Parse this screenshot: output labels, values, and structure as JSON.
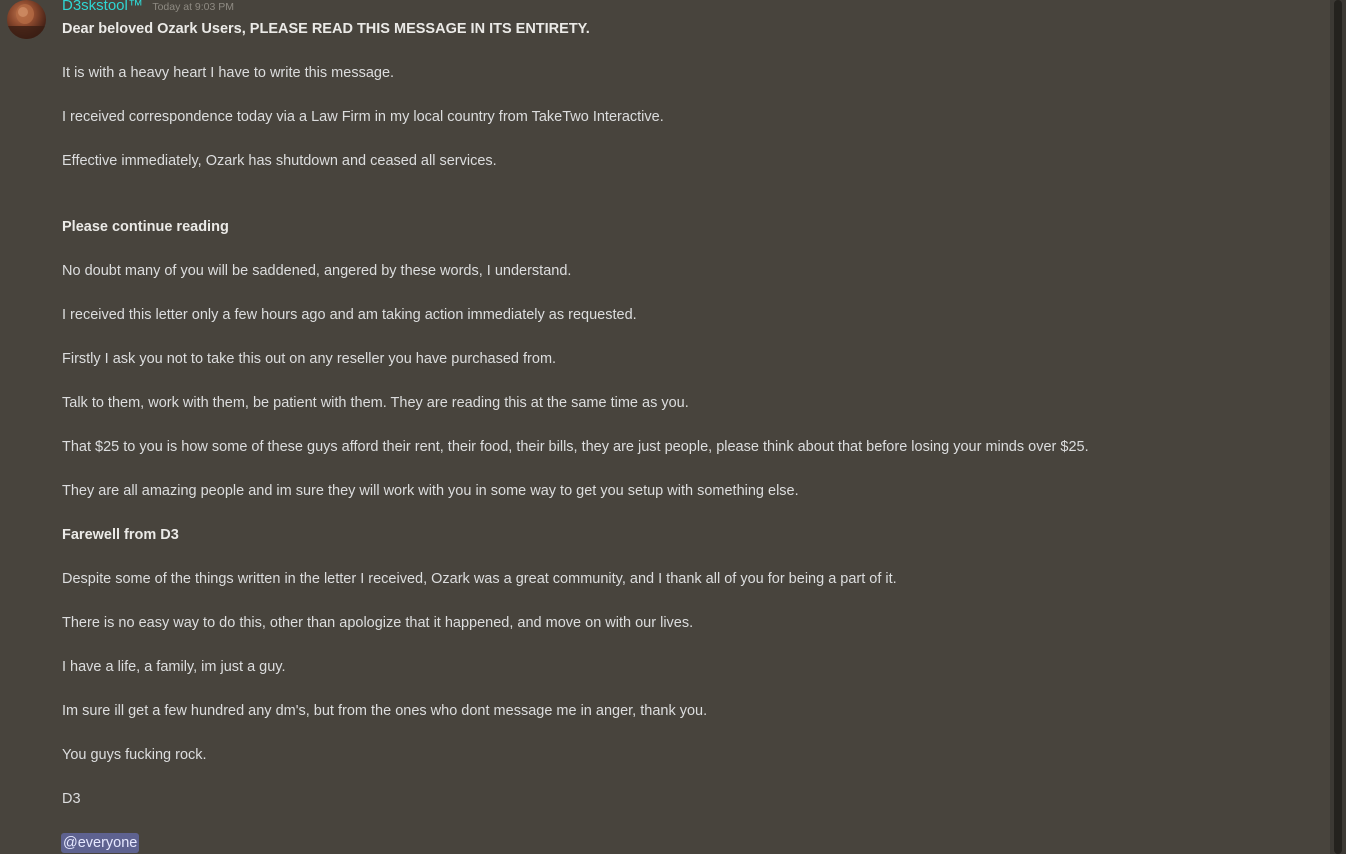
{
  "message": {
    "avatar_icon": "user-avatar-photo",
    "username": "D3skstool™",
    "timestamp": "Today at 9:03 PM",
    "username_color": "#2fd6d3",
    "lines": [
      "Dear beloved Ozark Users, PLEASE READ THIS MESSAGE IN ITS ENTIRETY.",
      "It is with a heavy heart I have to write this message.",
      "I received correspondence today via a Law Firm in my local country from TakeTwo Interactive.",
      "Effective immediately, Ozark has shutdown and ceased all services.",
      "Please continue reading",
      "No doubt many of you will be saddened, angered by these words, I understand.",
      "I received this letter only a few hours ago and am taking action immediately as requested.",
      "Firstly I ask you not to take this out on any reseller you have purchased from.",
      "Talk to them, work with them, be patient with them. They are reading this at the same time as you.",
      "That $25 to you is how some of these guys afford their rent, their food, their bills, they are just people, please think about that before losing your minds over $25.",
      "They are all amazing people and im sure they will work with you in some way to get you setup with something else.",
      "Farewell from D3",
      "Despite some of the things written in the letter I received, Ozark was a great community, and I thank all of you for being a part of it.",
      "There is no easy way to do this, other than apologize that it happened, and move on with our lives.",
      "I have a life, a family, im just a guy.",
      "Im sure ill get a few hundred any dm's, but from the ones who dont message me in anger, thank you.",
      "You guys fucking rock.",
      "D3"
    ],
    "mention": "@everyone",
    "mention_color": "#5e6290"
  }
}
